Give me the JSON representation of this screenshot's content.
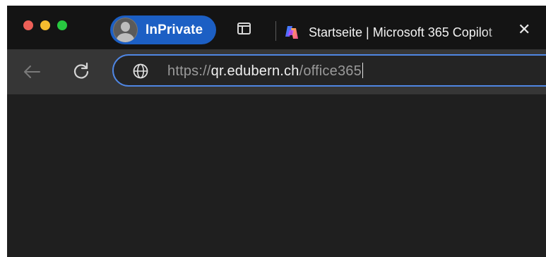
{
  "colors": {
    "traffic_red": "#ed5f57",
    "traffic_yellow": "#f5bc2f",
    "traffic_green": "#28c840",
    "inprivate_bg": "#1c5fc4",
    "focus_ring": "#4f86e3"
  },
  "profile": {
    "label": "InPrivate",
    "avatar_icon": "person-avatar-icon"
  },
  "tab": {
    "title": "Startseite | Microsoft 365 Copilot",
    "favicon": "copilot-icon",
    "close_glyph": "✕"
  },
  "toolbar": {
    "back_icon": "arrow-left-icon",
    "reload_icon": "reload-icon"
  },
  "address_bar": {
    "site_icon": "globe-icon",
    "url_scheme": "https://",
    "url_host": "qr.edubern.ch",
    "url_path": "/office365"
  }
}
